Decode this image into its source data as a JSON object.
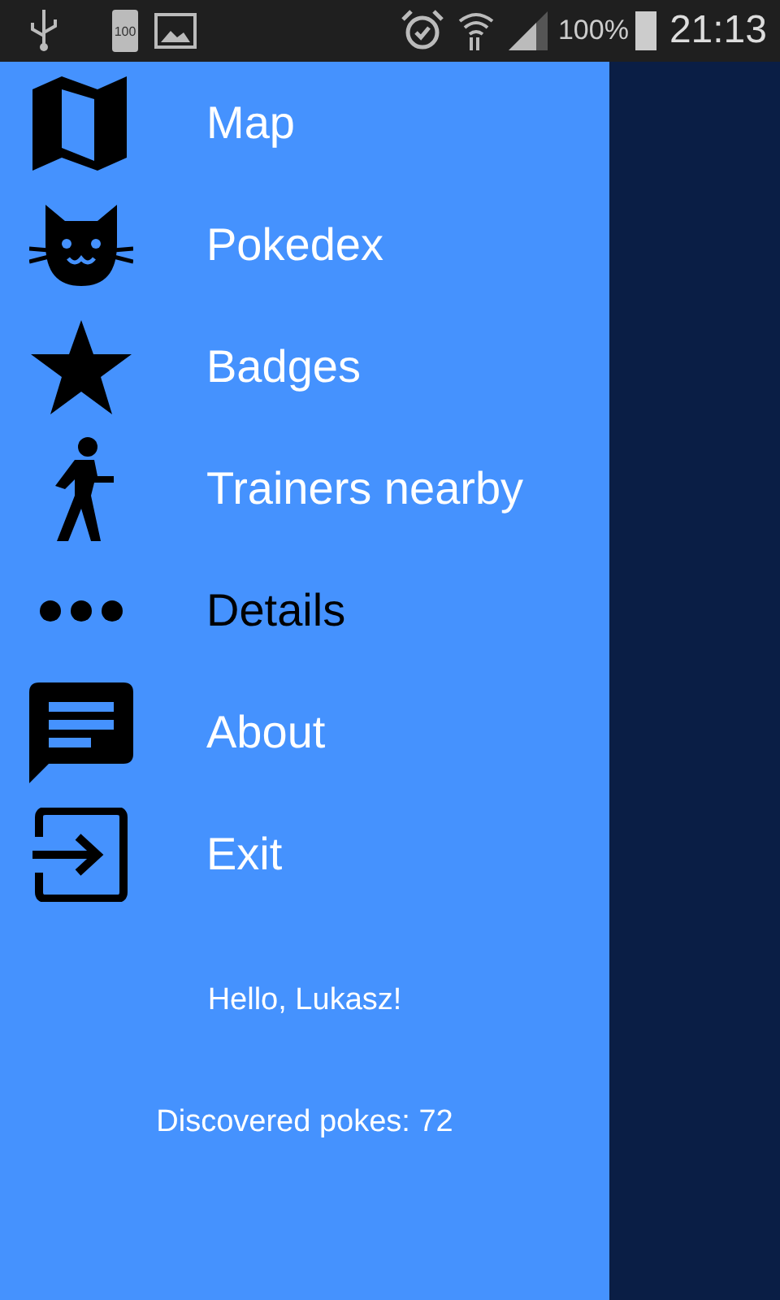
{
  "status_bar": {
    "battery_notice": "100",
    "battery_percent": "100%",
    "time": "21:13"
  },
  "drawer": {
    "items": [
      {
        "label": "Map",
        "selected": false
      },
      {
        "label": "Pokedex",
        "selected": false
      },
      {
        "label": "Badges",
        "selected": false
      },
      {
        "label": "Trainers nearby",
        "selected": false
      },
      {
        "label": "Details",
        "selected": true
      },
      {
        "label": "About",
        "selected": false
      },
      {
        "label": "Exit",
        "selected": false
      }
    ],
    "greeting": "Hello, Lukasz!",
    "discovered": "Discovered pokes: 72"
  }
}
